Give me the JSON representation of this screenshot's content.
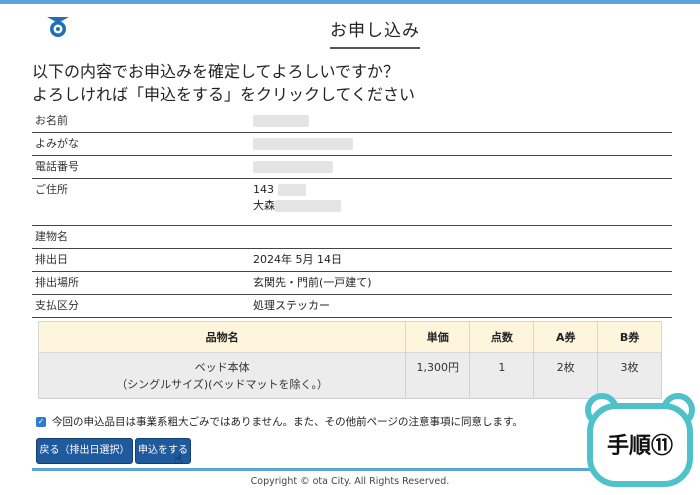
{
  "header": {
    "title": "お申し込み"
  },
  "confirm": {
    "line1": "以下の内容でお申込みを確定してよろしいですか？",
    "line2": "よろしければ「申込をする」をクリックしてください"
  },
  "info": {
    "name_label": "お名前",
    "kana_label": "よみがな",
    "phone_label": "電話番号",
    "address_label": "ご住所",
    "postal_partial": "143",
    "address_partial": "大森",
    "building_label": "建物名",
    "date_label": "排出日",
    "date_value": "2024年 5月 14日",
    "place_label": "排出場所",
    "place_value": "玄関先・門前(一戸建て)",
    "payment_label": "支払区分",
    "payment_value": "処理ステッカー"
  },
  "items": {
    "headers": [
      "品物名",
      "単価",
      "点数",
      "A券",
      "B券"
    ],
    "rows": [
      {
        "name_line1": "ベッド本体",
        "name_line2": "（シングルサイズ)(ベッドマットを除く。）",
        "price": "1,300円",
        "count": "1",
        "a": "2枚",
        "b": "3枚"
      }
    ]
  },
  "agree_text": "今回の申込品目は事業系粗大ごみではありません。また、その他前ページの注意事項に同意します。",
  "buttons": {
    "back": "戻る（排出日選択）",
    "apply": "申込をする"
  },
  "footer": {
    "copyright": "Copyright © ota City. All Rights Reserved."
  },
  "badge": {
    "label": "手順⑪"
  },
  "colors": {
    "accent": "#5aa4d6",
    "button": "#1f5a9c",
    "badge_border": "#4fc1c9",
    "header_row": "#fdf6dc"
  }
}
